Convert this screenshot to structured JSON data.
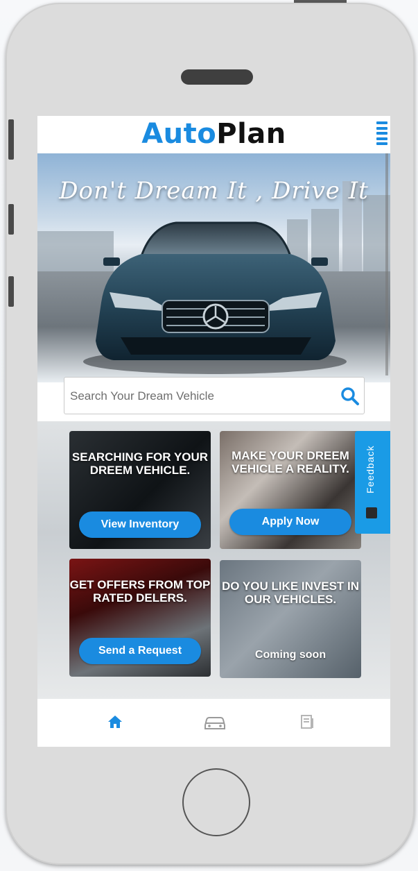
{
  "app": {
    "logo_part1": "Auto",
    "logo_part2": "Plan",
    "brand_color": "#1a8be0"
  },
  "hero": {
    "slogan": "Don't Dream It , Drive It"
  },
  "search": {
    "placeholder": "Search Your Dream Vehicle",
    "icon": "search-icon"
  },
  "cards": [
    {
      "caption": "SEARCHING FOR YOUR DREEM VEHICLE.",
      "button": "View Inventory"
    },
    {
      "caption": "MAKE YOUR DREEM VEHICLE A REALITY.",
      "button": "Apply Now"
    },
    {
      "caption": "GET OFFERS FROM TOP RATED DELERS.",
      "button": "Send a Request"
    },
    {
      "caption": "DO YOU LIKE INVEST IN OUR VEHICLES.",
      "status": "Coming soon"
    }
  ],
  "feedback": {
    "label": "Feedback",
    "color": "#1a9be6"
  },
  "bottom_nav": [
    {
      "icon": "home-icon",
      "active": true
    },
    {
      "icon": "car-icon",
      "active": false
    },
    {
      "icon": "document-icon",
      "active": false
    }
  ]
}
